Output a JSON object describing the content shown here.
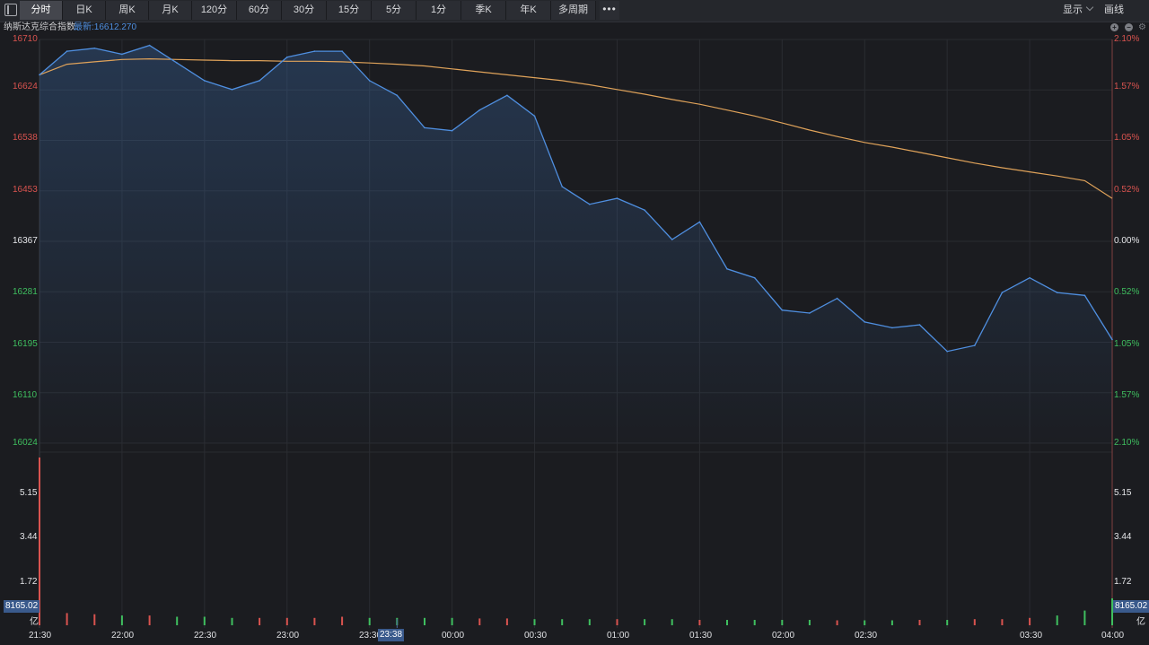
{
  "toolbar": {
    "tabs": [
      "分时",
      "日K",
      "周K",
      "月K",
      "120分",
      "60分",
      "30分",
      "15分",
      "5分",
      "1分",
      "季K",
      "年K",
      "多周期"
    ],
    "active_tab": "分时",
    "more": "•••",
    "display": "显示",
    "draw": "画线"
  },
  "header": {
    "index_name": "纳斯达克综合指数",
    "latest": "最新:16612.270",
    "controls": [
      "+",
      "−",
      "⚙"
    ]
  },
  "colors": {
    "price_line": "#4f8fe0",
    "avg_line": "#e0a35a",
    "up": "#d9534f",
    "down": "#3fbf5f",
    "grid": "#2a2c31"
  },
  "axis": {
    "price_labels": [
      "16710",
      "16624",
      "16538",
      "16453",
      "16367",
      "16281",
      "16195",
      "16110",
      "16024"
    ],
    "pct_labels": [
      "2.10%",
      "1.57%",
      "1.05%",
      "0.52%",
      "0.00%",
      "0.52%",
      "1.05%",
      "1.57%",
      "2.10%"
    ],
    "volume_labels": [
      "5.15",
      "3.44",
      "1.72"
    ],
    "volume_value": "8165.02",
    "volume_unit": "亿",
    "time_labels": [
      "21:30",
      "22:00",
      "22:30",
      "23:00",
      "23:30",
      "00:00",
      "00:30",
      "01:00",
      "01:30",
      "02:00",
      "02:30",
      "03:30",
      "04:00"
    ],
    "cursor_time": "23:38"
  },
  "chart_data": {
    "type": "line",
    "title": "纳斯达克综合指数",
    "x": [
      "21:30",
      "21:40",
      "21:50",
      "22:00",
      "22:10",
      "22:20",
      "22:30",
      "22:40",
      "22:50",
      "23:00",
      "23:10",
      "23:20",
      "23:30",
      "23:40",
      "23:50",
      "00:00",
      "00:10",
      "00:20",
      "00:30",
      "00:40",
      "00:50",
      "01:00",
      "01:10",
      "01:20",
      "01:30",
      "01:40",
      "01:50",
      "02:00",
      "02:10",
      "02:20",
      "02:30",
      "02:40",
      "02:50",
      "03:00",
      "03:10",
      "03:20",
      "03:30",
      "03:40",
      "03:50",
      "04:00"
    ],
    "ylim": [
      16024,
      16710
    ],
    "prev_close": 16367,
    "series": [
      {
        "values": [
          16650,
          16690,
          16695,
          16685,
          16700,
          16670,
          16640,
          16625,
          16640,
          16680,
          16690,
          16690,
          16640,
          16615,
          16560,
          16555,
          16590,
          16615,
          16580,
          16460,
          16430,
          16440,
          16420,
          16370,
          16400,
          16320,
          16305,
          16250,
          16245,
          16270,
          16230,
          16220,
          16225,
          16180,
          16190,
          16280,
          16305,
          16280,
          16275,
          16200
        ]
      },
      {
        "values": [
          16650,
          16668,
          16672,
          16676,
          16677,
          16676,
          16675,
          16674,
          16674,
          16673,
          16673,
          16672,
          16670,
          16668,
          16665,
          16660,
          16655,
          16650,
          16645,
          16640,
          16633,
          16625,
          16617,
          16608,
          16600,
          16590,
          16580,
          16568,
          16556,
          16545,
          16535,
          16527,
          16518,
          16509,
          16500,
          16492,
          16485,
          16478,
          16470,
          16440
        ]
      }
    ],
    "volume": [
      8165.02,
      0.5,
      0.45,
      0.4,
      0.4,
      0.35,
      0.35,
      0.3,
      0.3,
      0.3,
      0.3,
      0.35,
      0.3,
      0.3,
      0.3,
      0.3,
      0.28,
      0.28,
      0.25,
      0.25,
      0.25,
      0.25,
      0.25,
      0.25,
      0.22,
      0.22,
      0.22,
      0.22,
      0.22,
      0.2,
      0.2,
      0.2,
      0.22,
      0.22,
      0.25,
      0.25,
      0.3,
      0.4,
      0.6,
      1.1
    ],
    "volume_ylim": [
      0,
      6.86
    ]
  }
}
